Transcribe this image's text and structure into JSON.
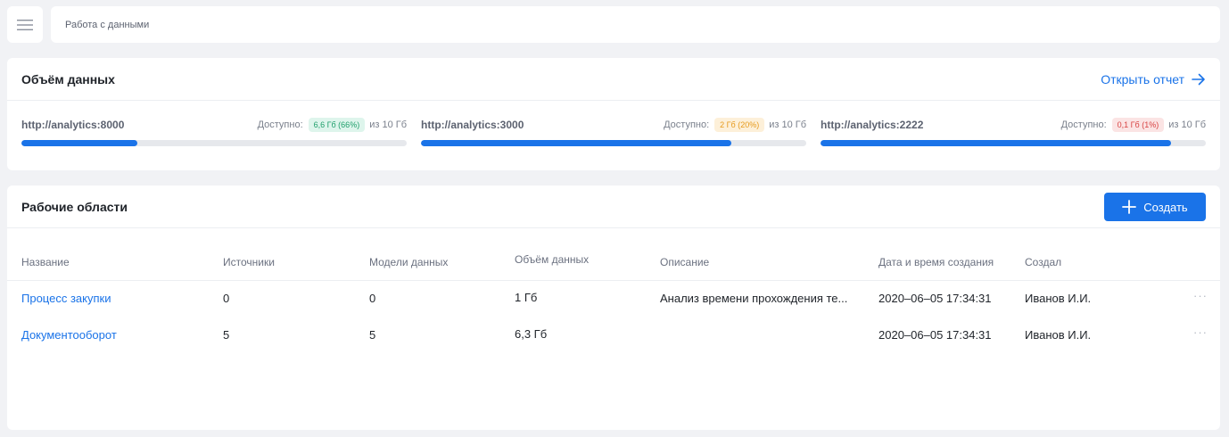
{
  "topbar": {
    "menu_icon": "hamburger-icon",
    "breadcrumb": "Работа с данными"
  },
  "volume": {
    "title": "Объём данных",
    "report_link": "Открыть отчет",
    "report_icon": "arrow-right-icon",
    "servers": [
      {
        "url": "http://analytics:8000",
        "available_label": "Доступно:",
        "badge": "6,6 Гб (66%)",
        "badge_bg": "#def5ec",
        "badge_color": "#1e9e6a",
        "of": "из 10 Гб",
        "fill": 0.3
      },
      {
        "url": "http://analytics:3000",
        "available_label": "Доступно:",
        "badge": "2 Гб (20%)",
        "badge_bg": "#fdf0d9",
        "badge_color": "#e69a1c",
        "of": "из 10 Гб",
        "fill": 0.805
      },
      {
        "url": "http://analytics:2222",
        "available_label": "Доступно:",
        "badge": "0,1 Гб (1%)",
        "badge_bg": "#fbe4e4",
        "badge_color": "#d84343",
        "of": "из 10 Гб",
        "fill": 0.91
      }
    ]
  },
  "workspaces": {
    "title": "Рабочие области",
    "create_label": "Создать",
    "create_icon": "plus-icon",
    "columns": [
      "Название",
      "Источники",
      "Модели данных",
      "Объём данных",
      "Описание",
      "Дата и время создания",
      "Создал"
    ],
    "rows": [
      {
        "name": "Процесс закупки",
        "sources": "0",
        "models": "0",
        "volume": "1 Гб",
        "description": "Анализ времени прохождения те...",
        "created": "2020–06–05 17:34:31",
        "author": "Иванов И.И.",
        "more": "···"
      },
      {
        "name": "Документооборот",
        "sources": "5",
        "models": "5",
        "volume": "6,3 Гб",
        "description": "",
        "created": "2020–06–05 17:34:31",
        "author": "Иванов И.И.",
        "more": "···"
      }
    ]
  },
  "colors": {
    "accent": "#1a73e8",
    "background": "#f1f2f5"
  }
}
